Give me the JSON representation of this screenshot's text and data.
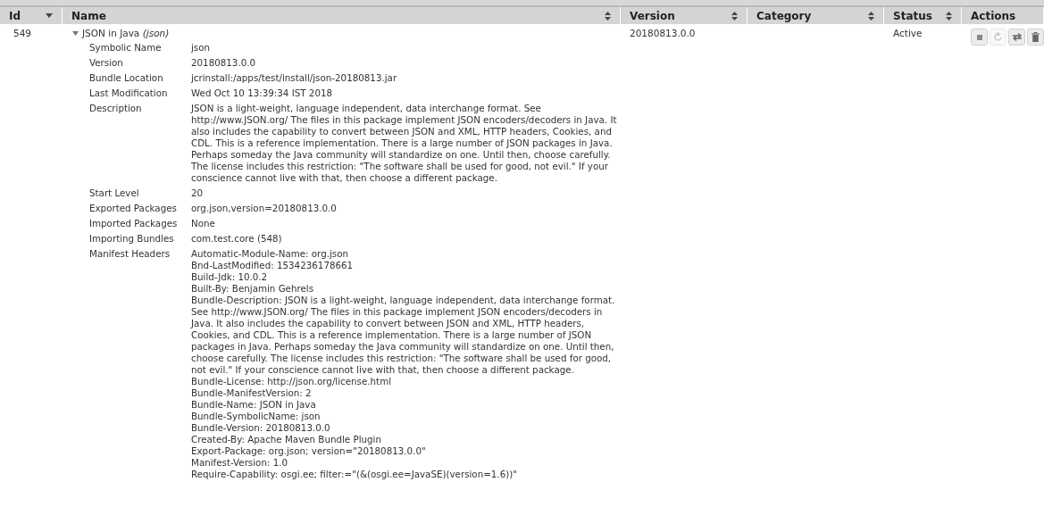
{
  "table": {
    "columns": [
      {
        "label": "Id",
        "sorted": true
      },
      {
        "label": "Name",
        "sorted": false
      },
      {
        "label": "Version",
        "sorted": false
      },
      {
        "label": "Category",
        "sorted": false
      },
      {
        "label": "Status",
        "sorted": false
      },
      {
        "label": "Actions"
      }
    ],
    "rows": [
      {
        "id": "549",
        "name": "JSON in Java",
        "symbolic": "(json)",
        "expanded": true,
        "version": "20180813.0.0",
        "status": "Active",
        "details": [
          {
            "label": "Symbolic Name",
            "lines": [
              "json"
            ]
          },
          {
            "label": "Version",
            "lines": [
              "20180813.0.0"
            ]
          },
          {
            "label": "Bundle Location",
            "lines": [
              "jcrinstall:/apps/test/install/json-20180813.jar"
            ]
          },
          {
            "label": "Last Modification",
            "lines": [
              "Wed Oct 10 13:39:34 IST 2018"
            ]
          },
          {
            "label": "Description",
            "lines": [
              "JSON is a light-weight, language independent, data interchange format. See http://www.JSON.org/ The files in this package implement JSON encoders/decoders in Java. It also includes the capability to convert between JSON and XML, HTTP headers, Cookies, and CDL. This is a reference implementation. There is a large number of JSON packages in Java. Perhaps someday the Java community will standardize on one. Until then, choose carefully. The license includes this restriction: \"The software shall be used for good, not evil.\" If your conscience cannot live with that, then choose a different package."
            ]
          },
          {
            "label": "Start Level",
            "lines": [
              "20"
            ]
          },
          {
            "label": "Exported Packages",
            "lines": [
              "org.json,version=20180813.0.0"
            ]
          },
          {
            "label": "Imported Packages",
            "lines": [
              "None"
            ]
          },
          {
            "label": "Importing Bundles",
            "lines": [
              "com.test.core (548)"
            ]
          },
          {
            "label": "Manifest Headers",
            "lines": [
              "Automatic-Module-Name: org.json",
              "Bnd-LastModified: 1534236178661",
              "Build-Jdk: 10.0.2",
              "Built-By: Benjamin Gehrels",
              "Bundle-Description: JSON is a light-weight, language independent, data interchange format. See http://www.JSON.org/ The files in this package implement JSON encoders/decoders in Java. It also includes the capability to convert between JSON and XML, HTTP headers, Cookies, and CDL. This is a reference implementation. There is a large number of JSON packages in Java. Perhaps someday the Java community will standardize on one. Until then, choose carefully. The license includes this restriction: \"The software shall be used for good, not evil.\" If your conscience cannot live with that, then choose a different package.",
              "Bundle-License: http://json.org/license.html",
              "Bundle-ManifestVersion: 2",
              "Bundle-Name: JSON in Java",
              "Bundle-SymbolicName: json",
              "Bundle-Version: 20180813.0.0",
              "Created-By: Apache Maven Bundle Plugin",
              "Export-Package: org.json; version=\"20180813.0.0\"",
              "Manifest-Version: 1.0",
              "Require-Capability: osgi.ee; filter:=\"(&(osgi.ee=JavaSE)(version=1.6))\""
            ]
          }
        ],
        "actions": [
          {
            "kind": "stop",
            "disabled": false
          },
          {
            "kind": "refresh",
            "disabled": true
          },
          {
            "kind": "update",
            "disabled": false
          },
          {
            "kind": "uninstall",
            "disabled": false
          }
        ]
      }
    ]
  }
}
